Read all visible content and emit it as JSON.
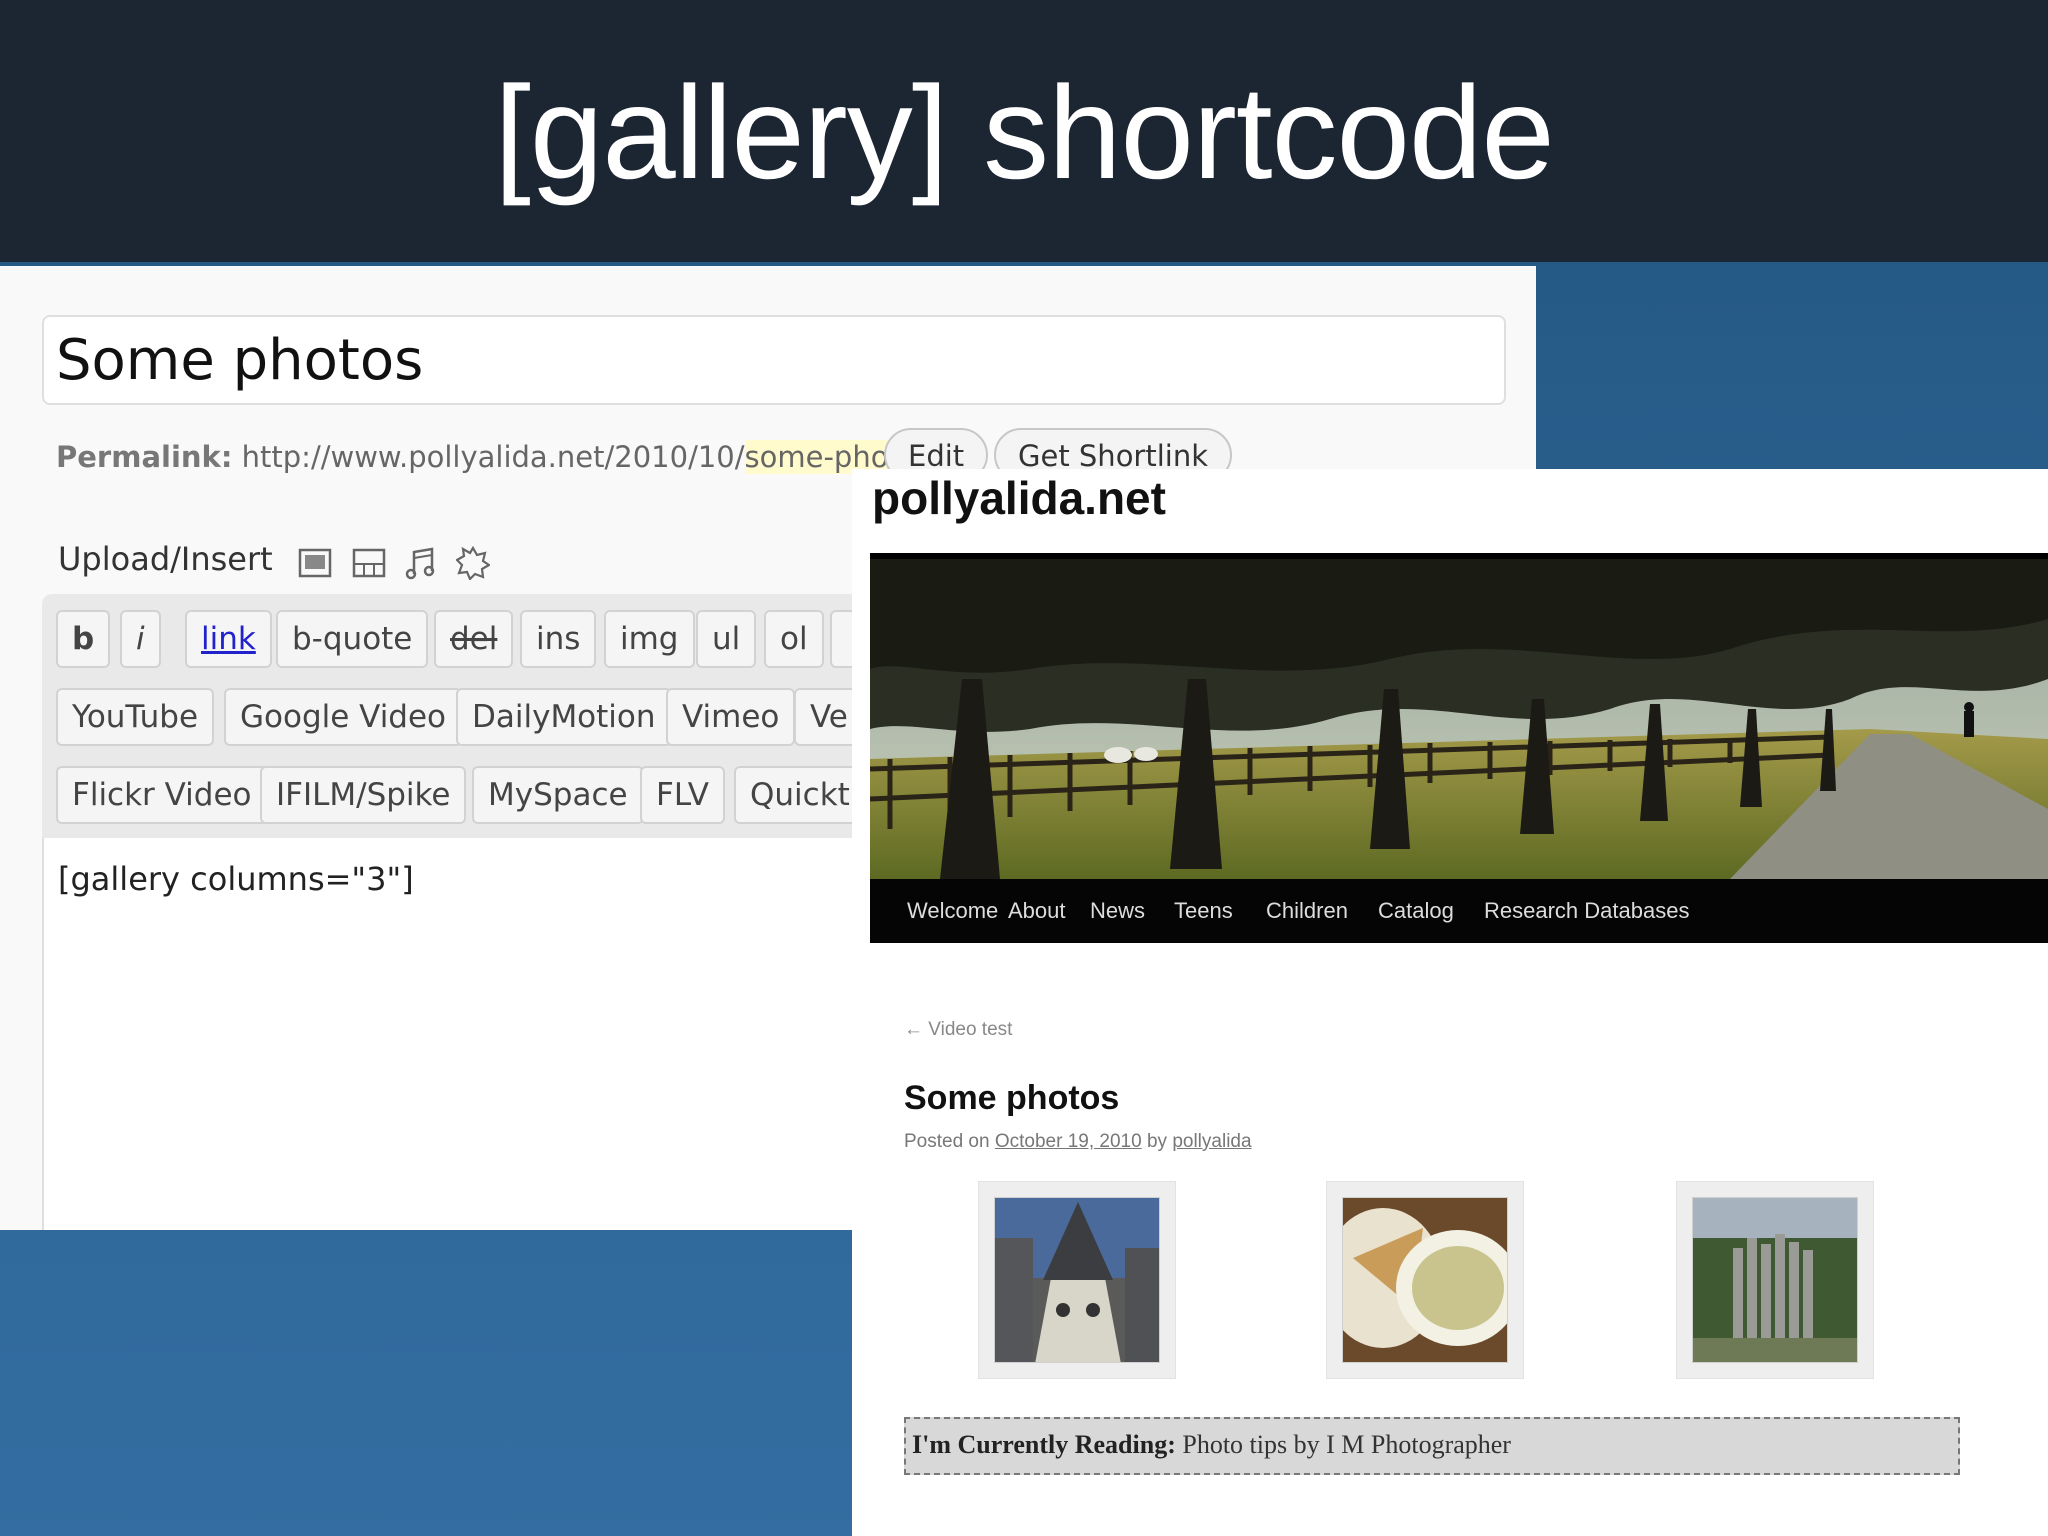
{
  "slide": {
    "title": "[gallery] shortcode"
  },
  "editor": {
    "post_title": "Some photos",
    "permalink_label": "Permalink:",
    "permalink_base": "http://www.pollyalida.net/2010/10/",
    "permalink_slug": "some-photos",
    "permalink_end": "/",
    "edit_button": "Edit",
    "shortlink_button": "Get Shortlink",
    "upload_insert_label": "Upload/Insert",
    "upload_icons": [
      "image-icon",
      "video-icon",
      "audio-icon",
      "media-icon"
    ],
    "quicktags_row1": [
      "b",
      "i",
      "link",
      "b-quote",
      "del",
      "ins",
      "img",
      "ul",
      "ol",
      ""
    ],
    "quicktags_row2": [
      "YouTube",
      "Google Video",
      "DailyMotion",
      "Vimeo",
      "Ve"
    ],
    "quicktags_row3": [
      "Flickr Video",
      "IFILM/Spike",
      "MySpace",
      "FLV",
      "Quickti"
    ],
    "content": "[gallery columns=\"3\"]"
  },
  "blog": {
    "site_name": "pollyalida.net",
    "nav": [
      "Welcome",
      "About",
      "News",
      "Teens",
      "Children",
      "Catalog",
      "Research Databases"
    ],
    "prev_link": "← Video test",
    "post_title": "Some photos",
    "posted_on": "Posted on",
    "date": "October 19, 2010",
    "by": "by",
    "author": "pollyalida",
    "gallery": [
      "castle-photo",
      "food-photo",
      "sculpture-photo"
    ],
    "reading_label": "I'm Currently Reading:",
    "reading_text": "Photo tips by I M Photographer"
  },
  "colors": {
    "header_bg": "#1c2633",
    "slide_bg": "#2d6494",
    "highlight": "#fffbcc",
    "link_blue": "#2222cc"
  }
}
